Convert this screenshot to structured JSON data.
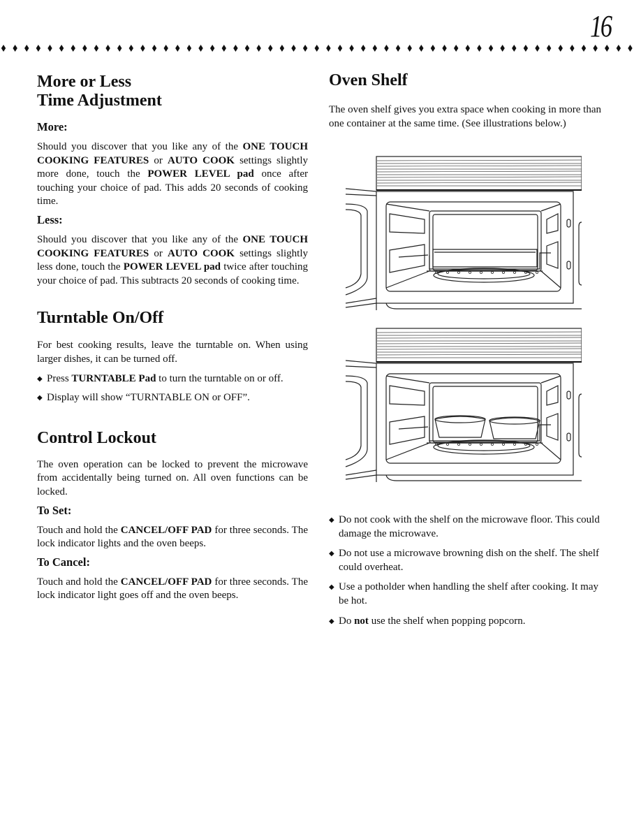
{
  "page": {
    "number": "16",
    "rule_glyph": "◆",
    "rule_count": 55
  },
  "more_less": {
    "title_line1": "More or Less",
    "title_line2": "Time Adjustment",
    "more_heading": "More:",
    "more_text": [
      {
        "t": "Should you discover that you like any of the ",
        "b": false
      },
      {
        "t": "ONE TOUCH COOKING FEATURES",
        "b": true
      },
      {
        "t": " or ",
        "b": false
      },
      {
        "t": "AUTO COOK",
        "b": true
      },
      {
        "t": " settings slightly more done, touch the ",
        "b": false
      },
      {
        "t": "POWER LEVEL pad",
        "b": true
      },
      {
        "t": " once after touching your choice of pad.  This adds 20 seconds of cooking time.",
        "b": false
      }
    ],
    "less_heading": "Less:",
    "less_text": [
      {
        "t": "Should you discover that you like any of the ",
        "b": false
      },
      {
        "t": "ONE TOUCH COOKING FEATURES",
        "b": true
      },
      {
        "t": " or ",
        "b": false
      },
      {
        "t": "AUTO COOK",
        "b": true
      },
      {
        "t": " settings slightly less done, touch the ",
        "b": false
      },
      {
        "t": "POWER LEVEL pad",
        "b": true
      },
      {
        "t": " twice after touching your choice of pad.  This subtracts 20 seconds of cooking time.",
        "b": false
      }
    ]
  },
  "turntable": {
    "title": "Turntable On/Off",
    "intro": "For best cooking results, leave the turntable on.  When using larger dishes, it can be turned off.",
    "bullets": [
      [
        {
          "t": "Press ",
          "b": false
        },
        {
          "t": "TURNTABLE Pad",
          "b": true
        },
        {
          "t": " to turn the turntable on or off.",
          "b": false
        }
      ],
      [
        {
          "t": "Display will show “TURNTABLE ON or OFF”.",
          "b": false
        }
      ]
    ]
  },
  "lockout": {
    "title": "Control Lockout",
    "intro": "The oven operation can be locked to prevent the microwave from accidentally being turned on. All oven functions can be locked.",
    "set_heading": "To Set:",
    "set_text": [
      {
        "t": "Touch and hold the ",
        "b": false
      },
      {
        "t": "CANCEL/OFF PAD",
        "b": true
      },
      {
        "t": " for three seconds. The lock indicator lights and the oven beeps.",
        "b": false
      }
    ],
    "cancel_heading": "To Cancel:",
    "cancel_text": [
      {
        "t": "Touch and hold the ",
        "b": false
      },
      {
        "t": "CANCEL/OFF PAD",
        "b": true
      },
      {
        "t": " for three seconds. The lock indicator light goes off and the oven beeps.",
        "b": false
      }
    ]
  },
  "shelf": {
    "title": "Oven Shelf",
    "intro": "The oven shelf gives you extra space when cooking in more than one container at the same time.  (See illustrations below.)",
    "illustrations": [
      {
        "label": "oven-with-shelf-and-casserole-dish"
      },
      {
        "label": "oven-with-shelf-and-two-bowls"
      }
    ],
    "bullets": [
      [
        {
          "t": "Do not cook with the shelf on the microwave floor.  This could damage the microwave.",
          "b": false
        }
      ],
      [
        {
          "t": "Do not use a microwave browning dish on the shelf.  The shelf could overheat.",
          "b": false
        }
      ],
      [
        {
          "t": "Use a potholder when handling the shelf after cooking. It may be hot.",
          "b": false
        }
      ],
      [
        {
          "t": "Do ",
          "b": false
        },
        {
          "t": "not",
          "b": true
        },
        {
          "t": " use the shelf when popping popcorn.",
          "b": false
        }
      ]
    ]
  }
}
